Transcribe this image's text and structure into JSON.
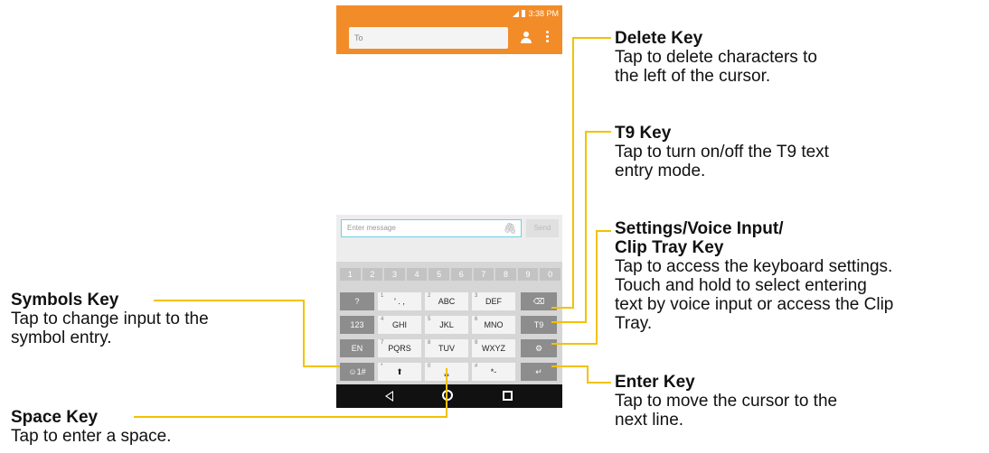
{
  "status_bar": {
    "time": "3:38 PM"
  },
  "app_bar": {
    "to_placeholder": "To"
  },
  "compose": {
    "message_placeholder": "Enter message",
    "send_label": "Send"
  },
  "keyboard": {
    "number_row": [
      "1",
      "2",
      "3",
      "4",
      "5",
      "6",
      "7",
      "8",
      "9",
      "0"
    ],
    "rows": [
      {
        "left": "?",
        "keys": [
          {
            "num": "1",
            "label": "' . ,"
          },
          {
            "num": "2",
            "label": "ABC"
          },
          {
            "num": "3",
            "label": "DEF"
          }
        ],
        "right": "⌫"
      },
      {
        "left": "123",
        "keys": [
          {
            "num": "4",
            "label": "GHI"
          },
          {
            "num": "5",
            "label": "JKL"
          },
          {
            "num": "6",
            "label": "MNO"
          }
        ],
        "right": "T9"
      },
      {
        "left": "EN",
        "keys": [
          {
            "num": "7",
            "label": "PQRS"
          },
          {
            "num": "8",
            "label": "TUV"
          },
          {
            "num": "9",
            "label": "WXYZ"
          }
        ],
        "right": "⚙"
      },
      {
        "left": "☺1#",
        "keys": [
          {
            "num": "*",
            "label": "⬆"
          },
          {
            "num": "0",
            "label": "␣"
          },
          {
            "num": "#",
            "label": "*-"
          }
        ],
        "right": "↵"
      }
    ]
  },
  "callouts": {
    "delete": {
      "title": "Delete Key",
      "desc1": "Tap to delete characters to",
      "desc2": "the left of the cursor."
    },
    "t9": {
      "title": "T9 Key",
      "desc1": "Tap to turn on/off the T9 text",
      "desc2": "entry mode."
    },
    "settings": {
      "title1": "Settings/Voice Input/",
      "title2": "Clip Tray Key",
      "desc1": "Tap to access the keyboard settings.",
      "desc2": "Touch and hold to select entering",
      "desc3": "text by voice input or access the Clip",
      "desc4": "Tray."
    },
    "enter": {
      "title": "Enter Key",
      "desc1": "Tap to move the cursor to the",
      "desc2": "next line."
    },
    "symbols": {
      "title": "Symbols Key",
      "desc1": "Tap to change input to the",
      "desc2": "symbol entry."
    },
    "space": {
      "title": "Space Key",
      "desc1": "Tap to enter a space."
    }
  },
  "colors": {
    "accent": "#f28c28",
    "callout_line": "#f2c200"
  }
}
